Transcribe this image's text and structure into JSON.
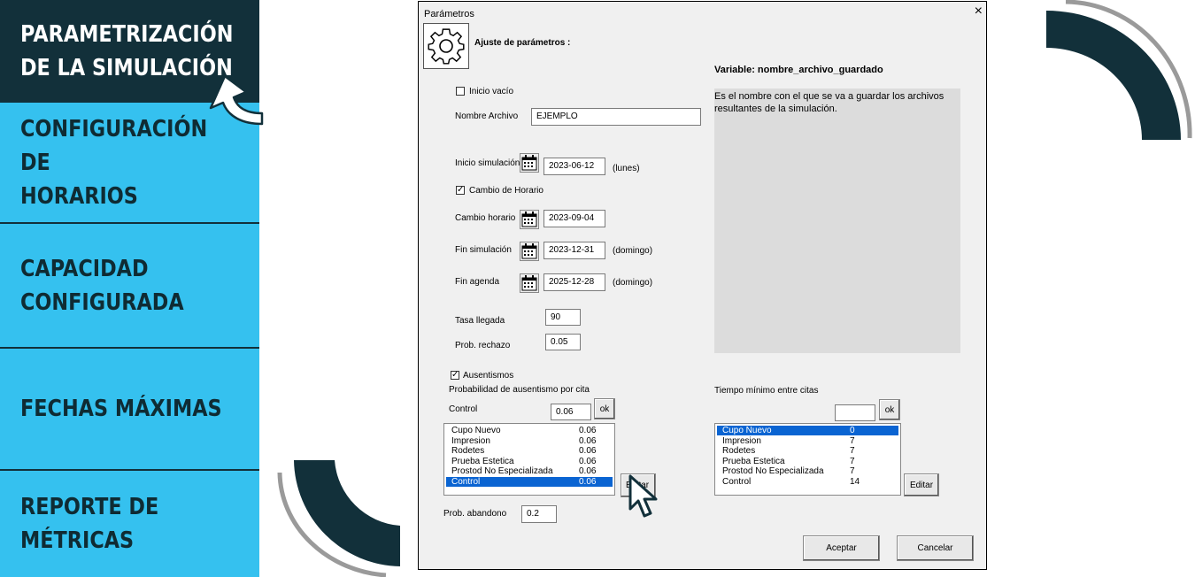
{
  "nav": {
    "items": [
      {
        "label": "PARAMETRIZACIÓN\nDE LA SIMULACIÓN"
      },
      {
        "label": "CONFIGURACIÓN DE\nHORARIOS"
      },
      {
        "label": "CAPACIDAD\nCONFIGURADA"
      },
      {
        "label": "FECHAS MÁXIMAS"
      },
      {
        "label": "REPORTE DE\nMÉTRICAS"
      }
    ]
  },
  "dialog": {
    "title": "Parámetros",
    "close": "×",
    "header": "Ajuste de parámetros :",
    "inicio_vacio": {
      "label": "Inicio vacío",
      "checked": "false"
    },
    "nombre_archivo": {
      "label": "Nombre Archivo",
      "value": "EJEMPLO"
    },
    "inicio_simulacion": {
      "label": "Inicio simulación",
      "value": "2023-06-12",
      "day": "(lunes)"
    },
    "cambio_de_horario": {
      "label": "Cambio de Horario",
      "checked": "true"
    },
    "cambio_horario": {
      "label": "Cambio horario",
      "value": "2023-09-04"
    },
    "fin_simulacion": {
      "label": "Fin simulación",
      "value": "2023-12-31",
      "day": "(domingo)"
    },
    "fin_agenda": {
      "label": "Fin agenda",
      "value": "2025-12-28",
      "day": "(domingo)"
    },
    "tasa_llegada": {
      "label": "Tasa llegada",
      "value": "90"
    },
    "prob_rechazo": {
      "label": "Prob. rechazo",
      "value": "0.05"
    },
    "ausentismos": {
      "label": "Ausentismos",
      "checked": "true"
    },
    "prob_ausentismo": {
      "label": "Probabilidad de ausentismo por cita",
      "selected_label": "Control",
      "selected_value": "0.06",
      "ok": "ok",
      "edit_button": "Editar",
      "items": [
        {
          "name": "Cupo Nuevo",
          "value": "0.06"
        },
        {
          "name": "Impresion",
          "value": "0.06"
        },
        {
          "name": "Rodetes",
          "value": "0.06"
        },
        {
          "name": "Prueba Estetica",
          "value": "0.06"
        },
        {
          "name": "Prostod No Especializada",
          "value": "0.06"
        },
        {
          "name": "Control",
          "value": "0.06"
        }
      ],
      "selected_index": 5
    },
    "prob_abandono": {
      "label": "Prob. abandono",
      "value": "0.2"
    },
    "variable": {
      "title": "Variable: nombre_archivo_guardado",
      "description": "Es el nombre con el que se va a guardar los archivos resultantes de la simulación."
    },
    "tiempo_minimo": {
      "label": "Tiempo mínimo entre citas",
      "value": "",
      "ok": "ok",
      "edit_button": "Editar",
      "items": [
        {
          "name": "Cupo Nuevo",
          "value": "0"
        },
        {
          "name": "Impresion",
          "value": "7"
        },
        {
          "name": "Rodetes",
          "value": "7"
        },
        {
          "name": "Prueba Estetica",
          "value": "7"
        },
        {
          "name": "Prostod No Especializada",
          "value": "7"
        },
        {
          "name": "Control",
          "value": "14"
        }
      ],
      "selected_index": 0
    },
    "aceptar": "Aceptar",
    "cancelar": "Cancelar"
  },
  "colors": {
    "nav_dark": "#12303a",
    "nav_light": "#35c1ef",
    "selection": "#0a64d2",
    "dialog_bg": "#f0f0f0"
  }
}
